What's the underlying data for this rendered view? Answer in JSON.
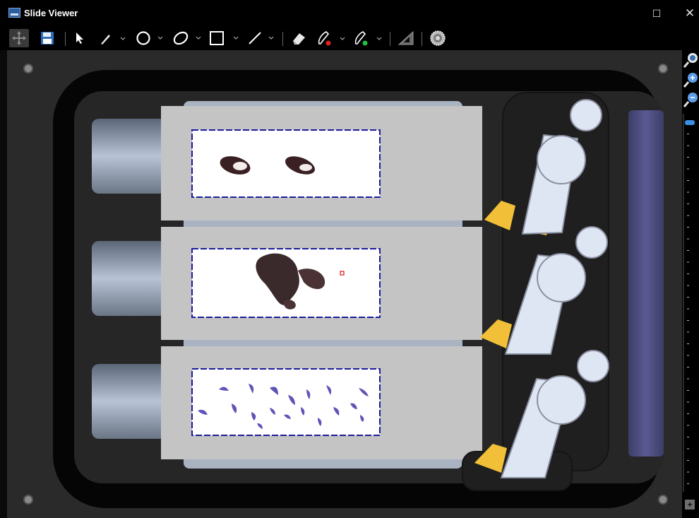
{
  "window": {
    "title": "Slide Viewer",
    "maximize_glyph": "☐",
    "close_glyph": "✕"
  },
  "toolbar": {
    "tools": [
      {
        "name": "pan-tool",
        "icon": "move-arrows-icon",
        "active": true
      },
      {
        "name": "save-tool",
        "icon": "floppy-disk-icon"
      },
      {
        "name": "select-tool",
        "icon": "cursor-arrow-icon"
      },
      {
        "name": "brush-tool",
        "icon": "brush-icon",
        "has_dropdown": true
      },
      {
        "name": "circle-tool",
        "icon": "circle-icon",
        "has_dropdown": true
      },
      {
        "name": "ellipse-tool",
        "icon": "ellipse-icon",
        "has_dropdown": true
      },
      {
        "name": "rectangle-tool",
        "icon": "rectangle-icon",
        "has_dropdown": true
      },
      {
        "name": "line-tool",
        "icon": "line-icon",
        "has_dropdown": true
      },
      {
        "name": "eraser-tool",
        "icon": "eraser-icon"
      },
      {
        "name": "negative-pen-tool",
        "icon": "pen-red-icon",
        "has_dropdown": true
      },
      {
        "name": "positive-pen-tool",
        "icon": "pen-green-icon",
        "has_dropdown": true
      },
      {
        "name": "measure-tool",
        "icon": "triangle-ruler-icon"
      },
      {
        "name": "settings-tool",
        "icon": "gear-icon"
      }
    ]
  },
  "viewer": {
    "slides": [
      {
        "name": "slide-1",
        "stain": "brown"
      },
      {
        "name": "slide-2",
        "stain": "brown"
      },
      {
        "name": "slide-3",
        "stain": "purple"
      }
    ],
    "colors": {
      "tray": "#1e1e1e",
      "slide": "#c4c4c4",
      "label_region": "#1c1c9c",
      "clip": "#f2c038",
      "handle": "#dfe6f3",
      "selection_marker": "#e01010"
    }
  },
  "zoom": {
    "icons": [
      "zoom-fit-icon",
      "zoom-in-icon",
      "zoom-out-icon"
    ],
    "level": 0.0,
    "plus_glyph": "+"
  }
}
